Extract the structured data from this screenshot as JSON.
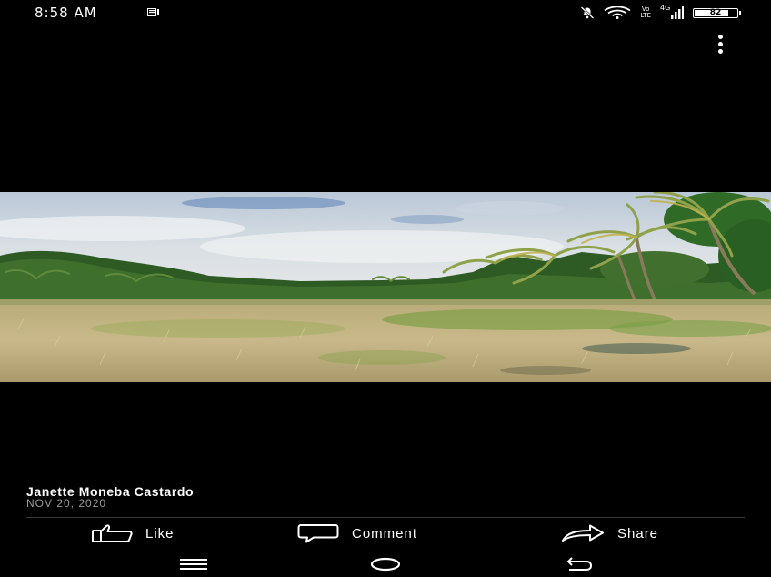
{
  "status_bar": {
    "time": "8:58 AM",
    "network_label_top": "Vo",
    "network_label_bottom": "LTE",
    "network_type": "4G",
    "battery_level": 82,
    "battery_text": "82",
    "icons": [
      "notification-icon",
      "mute-icon",
      "wifi-icon",
      "volte-icon",
      "signal-icon",
      "battery-icon"
    ]
  },
  "header": {
    "menu_icon": "more-vert-icon"
  },
  "post": {
    "author": "Janette Moneba Castardo",
    "date": "NOV 20, 2020"
  },
  "actions": {
    "like_label": "Like",
    "comment_label": "Comment",
    "share_label": "Share",
    "icons": [
      "thumbs-up-icon",
      "comment-icon",
      "share-icon"
    ]
  },
  "navigation": {
    "icons": [
      "recents-icon",
      "home-icon",
      "back-icon"
    ]
  }
}
